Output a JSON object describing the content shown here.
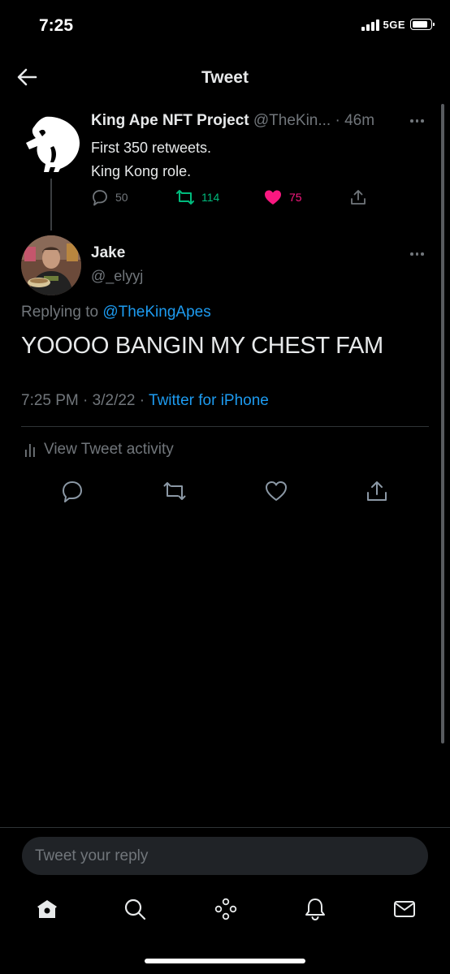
{
  "status_bar": {
    "time": "7:25",
    "network": "5GE",
    "battery_level": 0.85
  },
  "header": {
    "title": "Tweet",
    "back_icon": "arrow-left-icon"
  },
  "parent_tweet": {
    "author_name": "King Ape NFT Project",
    "author_handle": "@TheKin...",
    "time_ago": "· 46m",
    "lines": [
      "First 350 retweets.",
      "King Kong role."
    ],
    "reply_count": "50",
    "retweet_count": "114",
    "like_count": "75",
    "colors": {
      "retweet": "#00ba7c",
      "like": "#f91880",
      "muted": "#71767b"
    }
  },
  "reply_tweet": {
    "author_name": "Jake",
    "author_handle": "@_elyyj",
    "replying_prefix": "Replying to ",
    "replying_mention": "@TheKingApes",
    "text": "YOOOO BANGIN MY CHEST FAM",
    "time": "7:25 PM",
    "date": "3/2/22",
    "source": "Twitter for iPhone",
    "activity_label": "View Tweet activity"
  },
  "compose": {
    "placeholder": "Tweet your reply"
  },
  "nav": {
    "items": [
      "home-icon",
      "search-icon",
      "spaces-icon",
      "notifications-icon",
      "messages-icon"
    ]
  },
  "colors": {
    "accent": "#1d9bf0",
    "background": "#000000",
    "text": "#e7e9ea",
    "muted": "#71767b"
  }
}
